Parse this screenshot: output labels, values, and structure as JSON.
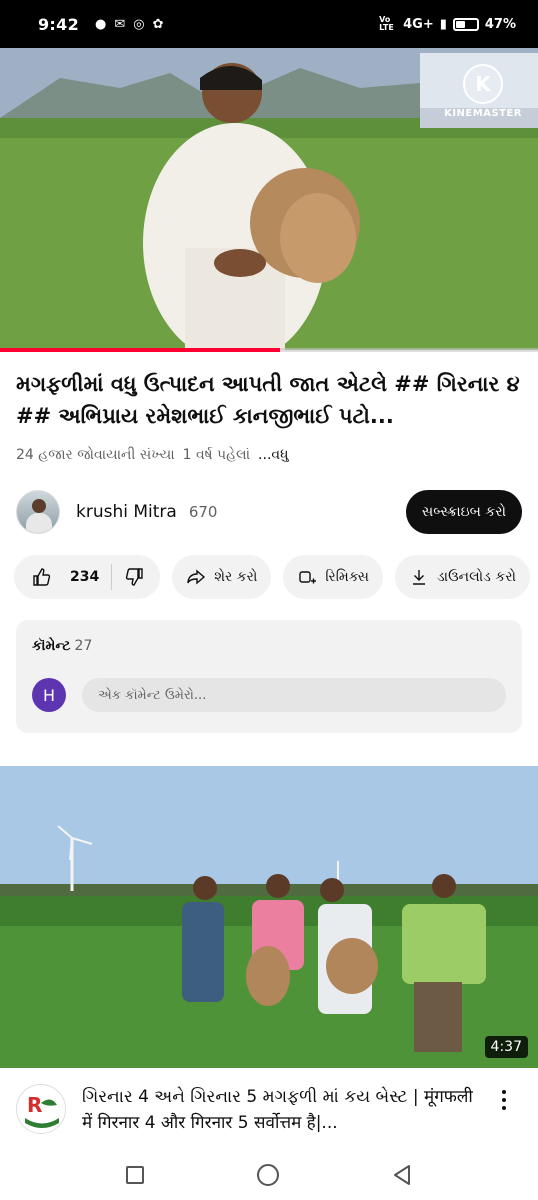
{
  "status_bar": {
    "time": "9:42",
    "network": "4G+",
    "volte": "Vo LTE",
    "battery_percent": "47%",
    "battery_level": 0.47
  },
  "player": {
    "watermark_letter": "K",
    "watermark_text": "KINEMASTER",
    "progress": 0.52
  },
  "video": {
    "title": "મગફળીમાં વધુ ઉત્પાદન આપતી જાત એટલે ## ગિરનાર ૪ ## અભિપ્રાય રમેશભાઈ કાનજીભાઈ પટો...",
    "views": "24 હજાર જોવાયાની સંખ્યા",
    "age": "1 વર્ષ પહેલાં",
    "more": "...વધુ"
  },
  "channel": {
    "name": "krushi Mitra",
    "subscribers": "670",
    "subscribe_label": "સબ્સ્ક્રાઇબ કરો"
  },
  "actions": {
    "like_count": "234",
    "share_label": "શેર કરો",
    "remix_label": "રિમિક્સ",
    "download_label": "ડાઉનલોડ કરો"
  },
  "comments": {
    "label": "કૉમેન્ટ",
    "count": "27",
    "user_initial": "H",
    "placeholder": "એક કૉમેન્ટ ઉમેરો..."
  },
  "next_video": {
    "duration": "4:37",
    "title": "ગિરનાર 4 અને ગિરનાર 5 મગફળી માં  કય બેસ્ટ | मूंगफली में गिरनार 4 और गिरनार 5 सर्वोत्तम है|..."
  },
  "colors": {
    "accent": "#ff0033",
    "text_primary": "#0f0f0f",
    "text_secondary": "#606060",
    "pill_bg": "#f2f2f2",
    "comment_avatar": "#5e35b1"
  }
}
